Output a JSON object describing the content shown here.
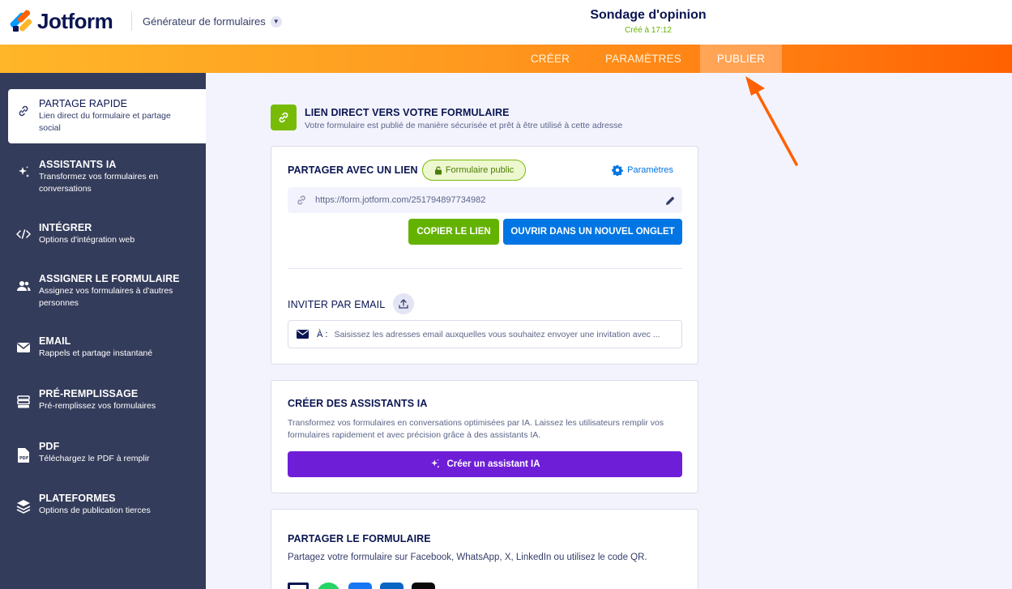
{
  "header": {
    "brand": "Jotform",
    "builder_menu": "Générateur de formulaires",
    "form_title": "Sondage d'opinion",
    "form_created": "Créé à 17:12"
  },
  "nav": {
    "tabs": [
      {
        "label": "CRÉER"
      },
      {
        "label": "PARAMÈTRES"
      },
      {
        "label": "PUBLIER",
        "active": true
      }
    ]
  },
  "sidebar": {
    "items": [
      {
        "title": "PARTAGE RAPIDE",
        "desc": "Lien direct du formulaire et partage social",
        "active": true,
        "icon": "link-icon"
      },
      {
        "title": "ASSISTANTS IA",
        "desc": "Transformez vos formulaires en conversations",
        "icon": "sparkle-icon"
      },
      {
        "title": "INTÉGRER",
        "desc": "Options d'intégration web",
        "icon": "code-icon"
      },
      {
        "title": "ASSIGNER LE FORMULAIRE",
        "desc": "Assignez vos formulaires à d'autres personnes",
        "icon": "users-icon"
      },
      {
        "title": "EMAIL",
        "desc": "Rappels et partage instantané",
        "icon": "envelope-icon"
      },
      {
        "title": "PRÉ-REMPLISSAGE",
        "desc": "Pré-remplissez vos formulaires",
        "icon": "prefill-icon"
      },
      {
        "title": "PDF",
        "desc": "Téléchargez le PDF à remplir",
        "icon": "pdf-icon"
      },
      {
        "title": "PLATEFORMES",
        "desc": "Options de publication tierces",
        "icon": "layers-icon"
      }
    ]
  },
  "main": {
    "section_title": "LIEN DIRECT VERS VOTRE FORMULAIRE",
    "section_sub": "Votre formulaire est publié de manière sécurisée et prêt à être utilisé à cette adresse",
    "share_link": {
      "title": "PARTAGER AVEC UN LIEN",
      "public_label": "Formulaire public",
      "settings_label": "Paramètres",
      "url": "https://form.jotform.com/251794897734982",
      "copy_label": "COPIER LE LIEN",
      "open_label": "OUVRIR DANS UN NOUVEL ONGLET"
    },
    "invite": {
      "title": "INVITER PAR EMAIL",
      "to_label": "À :",
      "placeholder": "Saisissez les adresses email auxquelles vous souhaitez envoyer une invitation avec ..."
    },
    "ai": {
      "title": "CRÉER DES ASSISTANTS IA",
      "desc": "Transformez vos formulaires en conversations optimisées par IA. Laissez les utilisateurs remplir vos formulaires rapidement et avec précision grâce à des assistants IA.",
      "button_label": "Créer un assistant IA"
    },
    "share_form": {
      "title": "PARTAGER LE FORMULAIRE",
      "desc": "Partagez votre formulaire sur Facebook, WhatsApp, X, LinkedIn ou utilisez le code QR.",
      "icons": [
        "qr-code-icon",
        "whatsapp-icon",
        "facebook-icon",
        "linkedin-icon",
        "x-icon"
      ]
    }
  },
  "colors": {
    "accent_orange": "#ff6100",
    "sidebar_bg": "#343c5b",
    "green": "#64b200",
    "blue": "#0075e3",
    "purple": "#6f1ed8"
  }
}
